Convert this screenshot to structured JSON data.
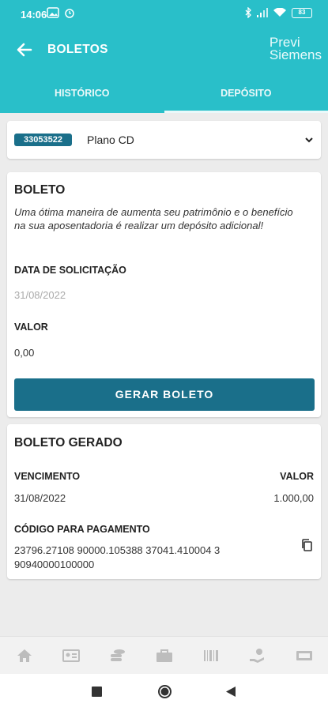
{
  "status": {
    "time": "14:06",
    "battery": "83"
  },
  "appbar": {
    "title": "BOLETOS",
    "logo_line1": "Previ",
    "logo_line2": "Siemens"
  },
  "tabs": [
    {
      "label": "HISTÓRICO"
    },
    {
      "label": "DEPÓSITO"
    }
  ],
  "plan": {
    "badge": "33053522",
    "name": "Plano CD"
  },
  "boleto": {
    "title": "BOLETO",
    "description": "Uma ótima maneira de aumenta seu patrimônio e o benefício na sua  aposentadoria é realizar um depósito adicional!",
    "date_label": "DATA DE SOLICITAÇÃO",
    "date_value": "31/08/2022",
    "valor_label": "VALOR",
    "valor_value": "0,00",
    "button": "GERAR BOLETO"
  },
  "gerado": {
    "title": "BOLETO GERADO",
    "venc_label": "VENCIMENTO",
    "valor_label": "VALOR",
    "venc_value": "31/08/2022",
    "valor_value": "1.000,00",
    "code_label": "CÓDIGO PARA PAGAMENTO",
    "code_line1": "23796.27108 90000.105388 37041.410004 3",
    "code_line2": "90940000100000"
  },
  "icons": {
    "nav": [
      "home-icon",
      "id-card-icon",
      "coins-icon",
      "briefcase-icon",
      "barcode-icon",
      "hand-coin-icon",
      "cash-icon"
    ]
  },
  "colors": {
    "primary": "#29bfc9",
    "accent": "#1a6f8a"
  }
}
